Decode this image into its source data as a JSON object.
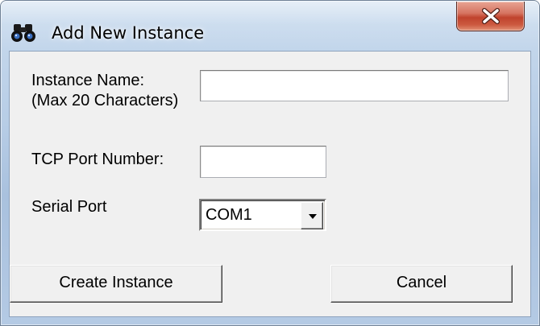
{
  "window": {
    "title": "Add New Instance",
    "title_icon": "binoculars-icon",
    "close_icon": "close-x-icon"
  },
  "form": {
    "instance_name": {
      "label_line1": "Instance Name:",
      "label_line2": "(Max 20 Characters)",
      "value": ""
    },
    "tcp_port": {
      "label": "TCP Port Number:",
      "value": ""
    },
    "serial_port": {
      "label": "Serial Port",
      "selected": "COM1",
      "dropdown_icon": "chevron-down-icon"
    }
  },
  "buttons": {
    "create_label": "Create Instance",
    "cancel_label": "Cancel"
  },
  "colors": {
    "window_frame": "#b7cde6",
    "close_button": "#c0432d",
    "client_background": "#f0f0f0"
  }
}
